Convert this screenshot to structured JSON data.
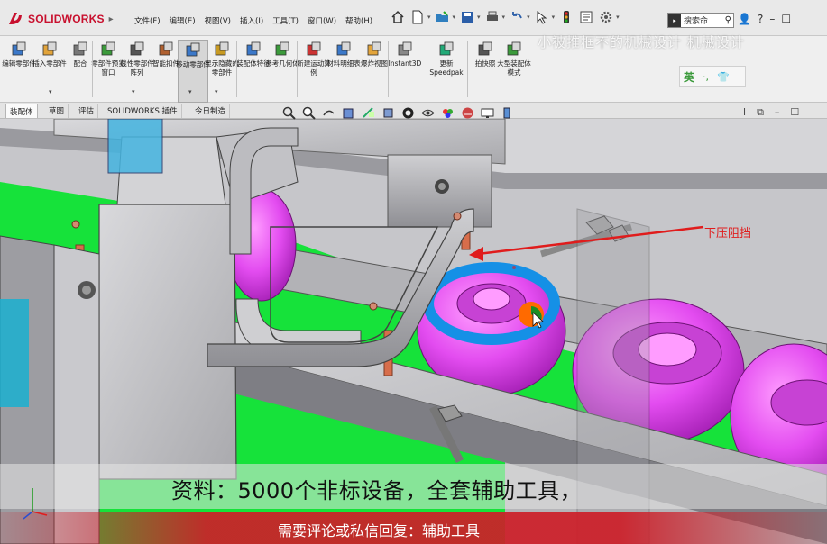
{
  "app": {
    "brand": "SOLIDWORKS",
    "colors": {
      "brand_red": "#c8102e",
      "callout_red": "#e01c1c",
      "part_magenta": "#e34cf0",
      "belt_green": "#16e23a",
      "highlight_blue": "#1590e6"
    }
  },
  "menu": [
    "文件(F)",
    "编辑(E)",
    "视图(V)",
    "插入(I)",
    "工具(T)",
    "窗口(W)",
    "帮助(H)"
  ],
  "quick_access": [
    "home-icon",
    "new-doc-icon",
    "open-icon",
    "save-icon",
    "print-icon",
    "undo-icon",
    "select-icon",
    "traffic-light-icon",
    "file-props-icon",
    "options-gear-icon"
  ],
  "search": {
    "lead": "▸",
    "placeholder": "搜索命"
  },
  "title_right": [
    "user-icon",
    "help-icon",
    "minimize-icon",
    "window-icon"
  ],
  "watermark": "小被推框不的机械设计 机械设计",
  "ribbon": [
    {
      "label": "编辑零部件",
      "icon": "edit-component-icon"
    },
    {
      "label": "插入零部件",
      "icon": "insert-component-icon"
    },
    {
      "label": "配合",
      "icon": "mate-icon"
    },
    {
      "label": "零部件预览窗口",
      "icon": "preview-window-icon"
    },
    {
      "label": "线性零部件阵列",
      "icon": "linear-pattern-icon"
    },
    {
      "label": "智能扣件",
      "icon": "smart-fastener-icon"
    },
    {
      "label": "移动零部件",
      "icon": "move-component-icon"
    },
    {
      "label": "显示隐藏的零部件",
      "icon": "show-hidden-icon"
    },
    {
      "label": "装配体特征",
      "icon": "assembly-feature-icon"
    },
    {
      "label": "参考几何体",
      "icon": "reference-geometry-icon"
    },
    {
      "label": "新建运动算例",
      "icon": "motion-study-icon"
    },
    {
      "label": "材料明细表",
      "icon": "bom-icon"
    },
    {
      "label": "爆炸视图",
      "icon": "exploded-view-icon"
    },
    {
      "label": "Instant3D",
      "icon": "instant3d-icon"
    },
    {
      "label": "更新Speedpak",
      "icon": "speedpak-icon"
    },
    {
      "label": "拍快照",
      "icon": "snapshot-icon"
    },
    {
      "label": "大型装配体模式",
      "icon": "large-assembly-icon"
    }
  ],
  "ime": {
    "mode": "英",
    "sym1": "·,",
    "sym2": "👕"
  },
  "tabs": [
    "装配体",
    "草图",
    "评估",
    "SOLIDWORKS 插件",
    "今日制造"
  ],
  "active_tab": 0,
  "viewport": {
    "callout": "下压阻挡"
  },
  "banners": {
    "line1": "资料：5000个非标设备，全套辅助工具，",
    "line2": "需要评论或私信回复：辅助工具"
  }
}
